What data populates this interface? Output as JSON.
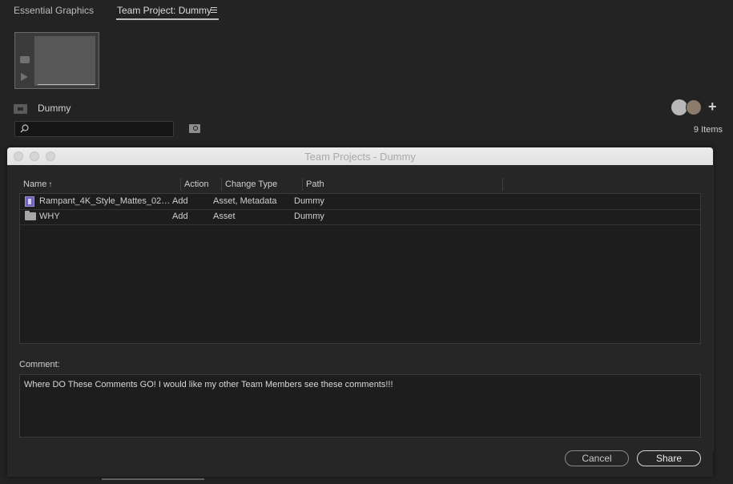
{
  "panel": {
    "tabs": [
      {
        "label": "Essential Graphics"
      },
      {
        "label": "Team Project: Dummy"
      }
    ],
    "project_name": "Dummy",
    "search": {
      "placeholder": ""
    },
    "items_count": "9 Items"
  },
  "dialog": {
    "title": "Team Projects - Dummy",
    "columns": {
      "name": "Name",
      "action": "Action",
      "change_type": "Change Type",
      "path": "Path"
    },
    "rows": [
      {
        "icon": "video-clip-icon",
        "name": "Rampant_4K_Style_Mattes_025...",
        "action": "Add",
        "change_type": "Asset, Metadata",
        "path": "Dummy"
      },
      {
        "icon": "folder-icon",
        "name": "WHY",
        "action": "Add",
        "change_type": "Asset",
        "path": "Dummy"
      }
    ],
    "comment_label": "Comment:",
    "comment_text": "Where DO These Comments GO!  I would like my other Team Members see these comments!!!",
    "buttons": {
      "cancel": "Cancel",
      "share": "Share"
    }
  },
  "colors": {
    "background": "#232323",
    "dialog_bg": "#262626",
    "list_bg": "#1d1d1d",
    "clip_icon": "#6f63b8"
  }
}
